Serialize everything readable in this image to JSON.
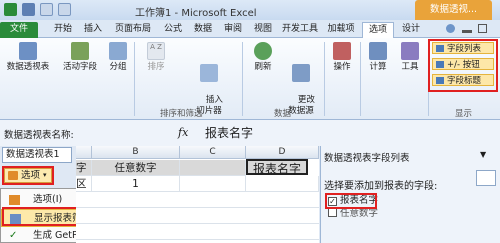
{
  "window": {
    "title": "工作簿1 - Microsoft Excel"
  },
  "context_group": "数据透视...",
  "tabs": [
    "文件",
    "开始",
    "插入",
    "页面布局",
    "公式",
    "数据",
    "审阅",
    "视图",
    "开发工具",
    "加载项",
    "选项",
    "设计"
  ],
  "ribbon": {
    "buttons": [
      "数据透视表",
      "活动字段",
      "分组",
      "排序",
      "插入\n切片器",
      "刷新",
      "更改\n数据源",
      "操作",
      "计算",
      "工具"
    ],
    "sort_icon_letters": "A Z",
    "groups": [
      "排序和筛选",
      "数据",
      "显示"
    ],
    "show": [
      "字段列表",
      "+/- 按钮",
      "字段标题"
    ]
  },
  "formula": {
    "name_label": "数据透视表名称:",
    "fx": "fx",
    "value": "报表名字"
  },
  "left": {
    "name_value": "数据透视表1",
    "options_label": "选项"
  },
  "menu": [
    "选项(I)",
    "显示报表筛选页(P)...",
    "生成 GetPivotData(G)"
  ],
  "grid": {
    "columns": [
      "B",
      "C",
      "D"
    ],
    "row1": [
      "字",
      "任意数字",
      "",
      "报表名字"
    ],
    "row2": [
      "区",
      "1",
      "",
      ""
    ]
  },
  "field_pane": {
    "title": "数据透视表字段列表",
    "header": "选择要添加到报表的字段:",
    "fields": [
      {
        "label": "报表名字",
        "checked": true
      },
      {
        "label": "任意数字",
        "checked": false
      }
    ]
  }
}
